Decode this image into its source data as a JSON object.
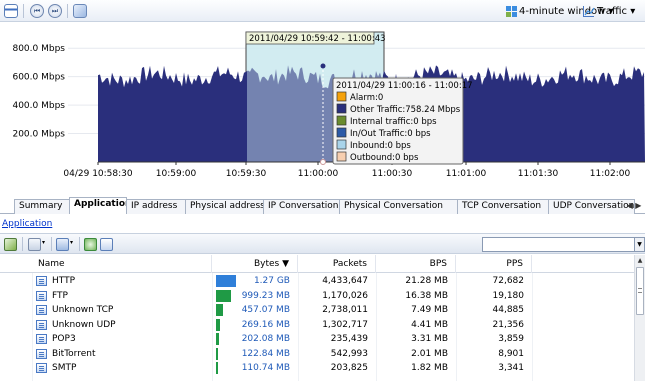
{
  "toolbar": {
    "window_label": "4-minute window",
    "traffic_label": "Traffic",
    "rewind_glyph": "⏮",
    "forward_glyph": "⏭",
    "icons": [
      "calendar-icon",
      "rewind-icon",
      "fast-forward-icon",
      "save-image-icon",
      "time-window-icon",
      "traffic-chart-icon"
    ]
  },
  "chart_data": {
    "type": "area",
    "ylabels": [
      "800.0 Mbps",
      "600.0 Mbps",
      "400.0 Mbps",
      "200.0 Mbps"
    ],
    "yvalues": [
      800,
      600,
      400,
      200
    ],
    "ylim": [
      0,
      900
    ],
    "xlabels": [
      "04/29 10:58:30",
      "10:59:00",
      "10:59:30",
      "11:00:00",
      "11:00:30",
      "11:01:00",
      "11:01:30",
      "11:02:00"
    ],
    "selection_label": "2011/04/29  10:59:42 - 11:00:43",
    "tooltip": {
      "title": "2011/04/29  11:00:16 - 11:00:17",
      "items": [
        {
          "label": "Alarm:0",
          "color": "#f5a10a"
        },
        {
          "label": "Other Traffic:758.24 Mbps",
          "color": "#2a2f7c"
        },
        {
          "label": "Internal traffic:0 bps",
          "color": "#6a8c2e"
        },
        {
          "label": "In/Out Traffic:0 bps",
          "color": "#2c5aa7"
        },
        {
          "label": "Inbound:0 bps",
          "color": "#a9d4ea"
        },
        {
          "label": "Outbound:0 bps",
          "color": "#f7cfb0"
        }
      ]
    },
    "series_color": "#2a2f7c",
    "selection_color": "#cfeaf0"
  },
  "tabs": [
    "Summary",
    "Application",
    "IP address",
    "Physical address",
    "IP Conversation",
    "Physical Conversation",
    "TCP Conversation",
    "UDP Conversation"
  ],
  "tab_scroll": "◀ ▶",
  "breadcrumb": "Application",
  "table": {
    "columns": [
      "Name",
      "Bytes ▼",
      "Packets",
      "BPS",
      "PPS"
    ],
    "rows": [
      {
        "name": "HTTP",
        "bytes": "1.27 GB",
        "packets": "4,433,647",
        "bps": "21.28 MB",
        "pps": "72,682",
        "share": 1.0
      },
      {
        "name": "FTP",
        "bytes": "999.23 MB",
        "packets": "1,170,026",
        "bps": "16.38 MB",
        "pps": "19,180",
        "share": 0.77
      },
      {
        "name": "Unknown TCP",
        "bytes": "457.07 MB",
        "packets": "2,738,011",
        "bps": "7.49 MB",
        "pps": "44,885",
        "share": 0.35
      },
      {
        "name": "Unknown UDP",
        "bytes": "269.16 MB",
        "packets": "1,302,717",
        "bps": "4.41 MB",
        "pps": "21,356",
        "share": 0.21
      },
      {
        "name": "POP3",
        "bytes": "202.08 MB",
        "packets": "235,439",
        "bps": "3.31 MB",
        "pps": "3,859",
        "share": 0.16
      },
      {
        "name": "BitTorrent",
        "bytes": "122.84 MB",
        "packets": "542,993",
        "bps": "2.01 MB",
        "pps": "8,901",
        "share": 0.09
      },
      {
        "name": "SMTP",
        "bytes": "110.74 MB",
        "packets": "203,825",
        "bps": "1.82 MB",
        "pps": "3,341",
        "share": 0.08
      }
    ],
    "bar_colors": [
      "#2f7fd9",
      "#1f9a45"
    ]
  }
}
